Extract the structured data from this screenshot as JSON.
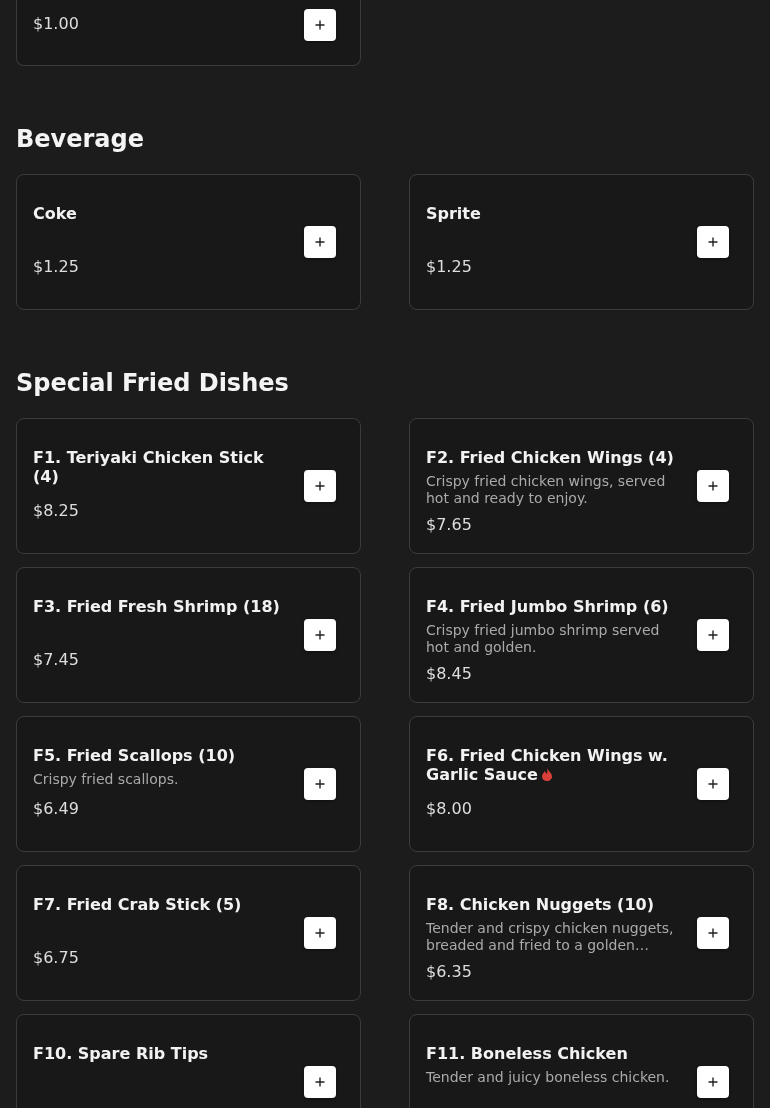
{
  "top_item": {
    "price": "$1.00"
  },
  "sections": [
    {
      "title": "Beverage",
      "items": [
        {
          "name": "Coke",
          "price": "$1.25",
          "spicy": false
        },
        {
          "name": "Sprite",
          "price": "$1.25",
          "spicy": false
        }
      ]
    },
    {
      "title": "Special Fried Dishes",
      "items": [
        {
          "name": "F1. Teriyaki Chicken Stick (4)",
          "price": "$8.25",
          "spicy": false
        },
        {
          "name": "F2. Fried Chicken Wings (4)",
          "description": "Crispy fried chicken wings, served hot and ready to enjoy.",
          "price": "$7.65",
          "spicy": false
        },
        {
          "name": "F3. Fried Fresh Shrimp (18)",
          "price": "$7.45",
          "spicy": false
        },
        {
          "name": "F4. Fried Jumbo Shrimp (6)",
          "description": "Crispy fried jumbo shrimp served hot and golden.",
          "price": "$8.45",
          "spicy": false
        },
        {
          "name": "F5. Fried Scallops (10)",
          "description": "Crispy fried scallops.",
          "price": "$6.49",
          "spicy": false
        },
        {
          "name": "F6. Fried Chicken Wings w. Garlic Sauce",
          "price": "$8.00",
          "spicy": true
        },
        {
          "name": "F7. Fried Crab Stick (5)",
          "price": "$6.75",
          "spicy": false
        },
        {
          "name": "F8. Chicken Nuggets (10)",
          "description": "Tender and crispy chicken nuggets, breaded and fried to a golden…",
          "price": "$6.35",
          "spicy": false
        },
        {
          "name": "F10. Spare Rib Tips",
          "spicy": false
        },
        {
          "name": "F11. Boneless Chicken",
          "description": "Tender and juicy boneless chicken.",
          "spicy": false
        }
      ]
    }
  ]
}
